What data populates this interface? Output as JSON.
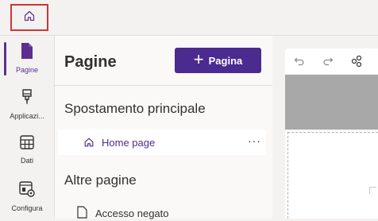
{
  "topbar": {
    "home_icon": "home-icon",
    "highlight_color": "#d13438"
  },
  "rail": {
    "items": [
      {
        "label": "Pagine",
        "icon": "page-icon",
        "active": true
      },
      {
        "label": "Applicazi...",
        "icon": "brush-icon",
        "active": false
      },
      {
        "label": "Dati",
        "icon": "table-icon",
        "active": false
      },
      {
        "label": "Configura",
        "icon": "settings-page-icon",
        "active": false
      }
    ]
  },
  "pages_panel": {
    "title": "Pagine",
    "add_button_label": "Pagina",
    "main_nav_heading": "Spostamento principale",
    "main_nav_item": "Home page",
    "more_label": "···",
    "other_pages_heading": "Altre pagine",
    "other_pages_item": "Accesso negato"
  },
  "colors": {
    "accent": "#4b2b8f",
    "active_rail": "#5c2e91"
  }
}
